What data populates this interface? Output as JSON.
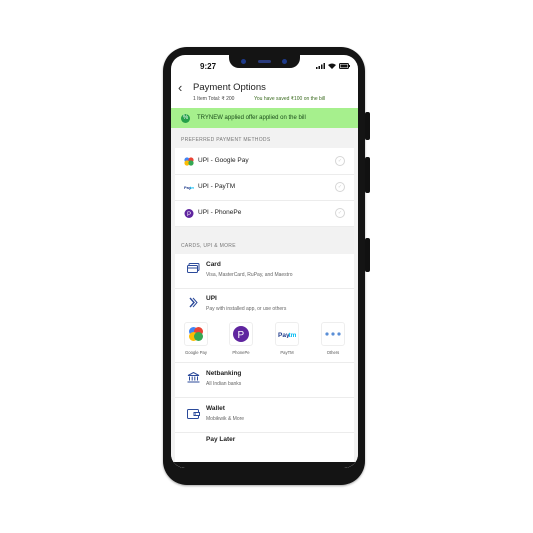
{
  "status_bar": {
    "time": "9:27"
  },
  "header": {
    "title": "Payment Options",
    "items_total": "1 Item Total: ₹ 200",
    "savings": "You have saved ₹100 on the bill"
  },
  "offer_banner": {
    "text": "TRYNEW applied offer applied on the bill"
  },
  "preferred": {
    "section_title": "PREFERRED PAYMENT METHODS",
    "items": [
      {
        "label": "UPI - Google Pay",
        "icon": "google-pay-icon"
      },
      {
        "label": "UPI - PayTM",
        "icon": "paytm-icon"
      },
      {
        "label": "UPI - PhonePe",
        "icon": "phonepe-icon"
      }
    ]
  },
  "more": {
    "section_title": "CARDS, UPI & MORE",
    "card": {
      "title": "Card",
      "subtitle": "Visa, MasterCard, RuPay, and Maestro"
    },
    "upi": {
      "title": "UPI",
      "subtitle": "Pay with installed app, or use others",
      "apps": [
        {
          "name": "Google Pay"
        },
        {
          "name": "PhonePe"
        },
        {
          "name": "PayTM"
        },
        {
          "name": "Others"
        }
      ]
    },
    "netbanking": {
      "title": "Netbanking",
      "subtitle": "All Indian banks"
    },
    "wallet": {
      "title": "Wallet",
      "subtitle": "Mobikwik & More"
    },
    "pay_later": {
      "title": "Pay Later"
    }
  },
  "colors": {
    "offer_bg": "#a6f08d",
    "offer_icon": "#25a04a",
    "phonepe": "#5f259f",
    "paytm": "#00baf2",
    "upi_icon": "#2b4a9a"
  }
}
